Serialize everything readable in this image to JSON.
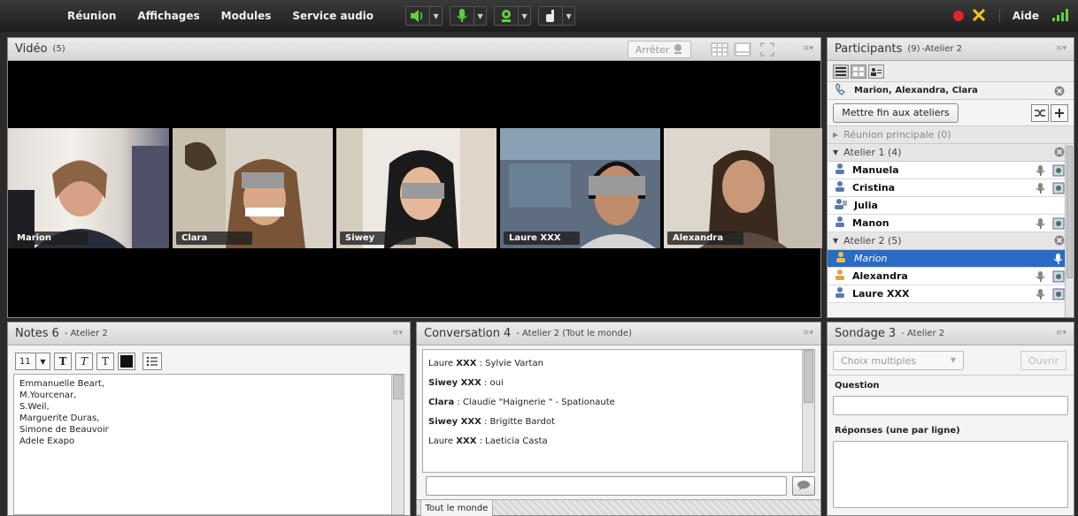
{
  "menu": [
    "Réunion",
    "Affichages",
    "Modules",
    "Service audio"
  ],
  "help": "Aide",
  "video": {
    "title": "Vidéo",
    "count": "(5)",
    "stop_label": "Arrêter",
    "participants": [
      "Marion",
      "Clara",
      "Siwey",
      "Laure XXX",
      "Alexandra"
    ]
  },
  "participants": {
    "title": "Participants",
    "count": "(9)",
    "sub": "-Atelier 2",
    "speaking": "Marion, Alexandra, Clara",
    "end_breakouts": "Mettre fin aux ateliers",
    "main_room": "Réunion principale (0)",
    "groups": [
      {
        "label": "Atelier 1 (4)",
        "members": [
          "Manuela",
          "Cristina",
          "Julia",
          "Manon"
        ]
      },
      {
        "label": "Atelier 2 (5)",
        "members": [
          "Marion",
          "Alexandra",
          "Laure XXX"
        ]
      }
    ]
  },
  "notes": {
    "title": "Notes",
    "count": "6",
    "sub": "- Atelier 2",
    "font_size": "11",
    "lines": [
      "Emmanuelle Beart,",
      "M.Yourcenar,",
      "S.Weil,",
      "Marguerite Duras,",
      "Simone de Beauvoir",
      "Adele Exapo"
    ]
  },
  "chat": {
    "title": "Conversation",
    "count": "4",
    "sub": "- Atelier 2 (Tout le monde)",
    "messages": [
      {
        "who": "Laure",
        "who2": "XXX",
        "text": " : Sylvie Vartan"
      },
      {
        "who": "Siwey XXX",
        "who2": "",
        "text": " : oui"
      },
      {
        "who": "Clara",
        "who2": "",
        "text": " : Claudie \"Haignerie \"  - Spationaute"
      },
      {
        "who": "Siwey XXX",
        "who2": "",
        "text": " : Brigitte Bardot"
      },
      {
        "who": "Laure",
        "who2": "XXX",
        "text": " : Laeticia Casta"
      }
    ],
    "tab": "Tout le monde"
  },
  "poll": {
    "title": "Sondage",
    "count": "3",
    "sub": "- Atelier 2",
    "type": "Choix multiples",
    "open": "Ouvrir",
    "question_label": "Question",
    "answers_label": "Réponses (une par ligne)"
  },
  "colors": {
    "selected": "#2a6bc6",
    "record": "#e8202a"
  }
}
